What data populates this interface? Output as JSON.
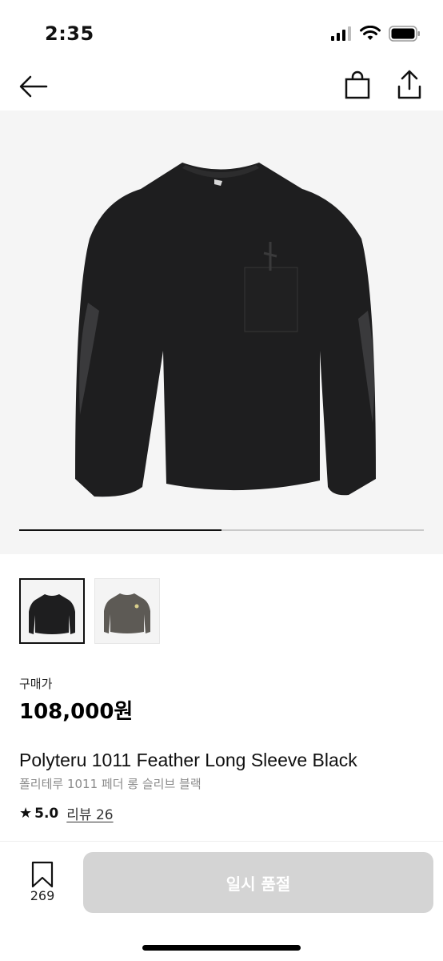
{
  "status_bar": {
    "time": "2:35"
  },
  "nav": {
    "back_icon": "arrow-left-icon",
    "bag_icon": "shopping-bag-icon",
    "share_icon": "share-icon"
  },
  "gallery": {
    "progress_fraction": 0.5,
    "thumbnails": [
      {
        "color": "#1e1e1f",
        "selected": true
      },
      {
        "color": "#5d5a55",
        "selected": false
      }
    ]
  },
  "product": {
    "price_label": "구매가",
    "price": "108,000원",
    "name": "Polyteru 1011 Feather Long Sleeve Black",
    "name_ko": "폴리테루 1011 페더 롱 슬리브 블랙",
    "rating_star": "★",
    "rating": "5.0",
    "review_link": "리뷰 26"
  },
  "bottom_bar": {
    "bookmark_count": "269",
    "buy_button_label": "일시 품절"
  },
  "colors": {
    "shirt": "#1e1e1f",
    "hero_bg": "#f5f5f5",
    "button_disabled": "#d4d4d4"
  }
}
